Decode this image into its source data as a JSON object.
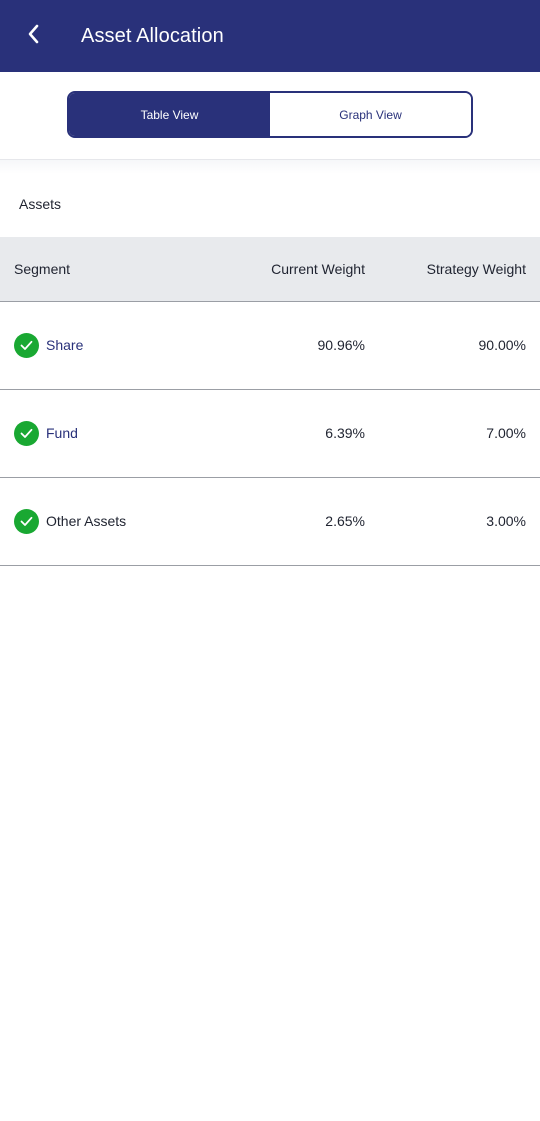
{
  "header": {
    "title": "Asset Allocation",
    "back_icon": "chevron-left-icon",
    "background_color": "#29317a"
  },
  "view_toggle": {
    "options": [
      {
        "label": "Table View",
        "active": true
      },
      {
        "label": "Graph View",
        "active": false
      }
    ]
  },
  "section": {
    "label": "Assets"
  },
  "table": {
    "columns": [
      "Segment",
      "Current Weight",
      "Strategy Weight"
    ],
    "rows": [
      {
        "segment": "Share",
        "current_weight": "90.96%",
        "strategy_weight": "90.00%",
        "status_icon": "check-circle-icon"
      },
      {
        "segment": "Fund",
        "current_weight": "6.39%",
        "strategy_weight": "7.00%",
        "status_icon": "check-circle-icon"
      },
      {
        "segment": "Other Assets",
        "current_weight": "2.65%",
        "strategy_weight": "3.00%",
        "status_icon": "check-circle-icon"
      }
    ]
  },
  "colors": {
    "accent": "#29317a",
    "success": "#19a832",
    "header_row_bg": "#e8eaed"
  }
}
